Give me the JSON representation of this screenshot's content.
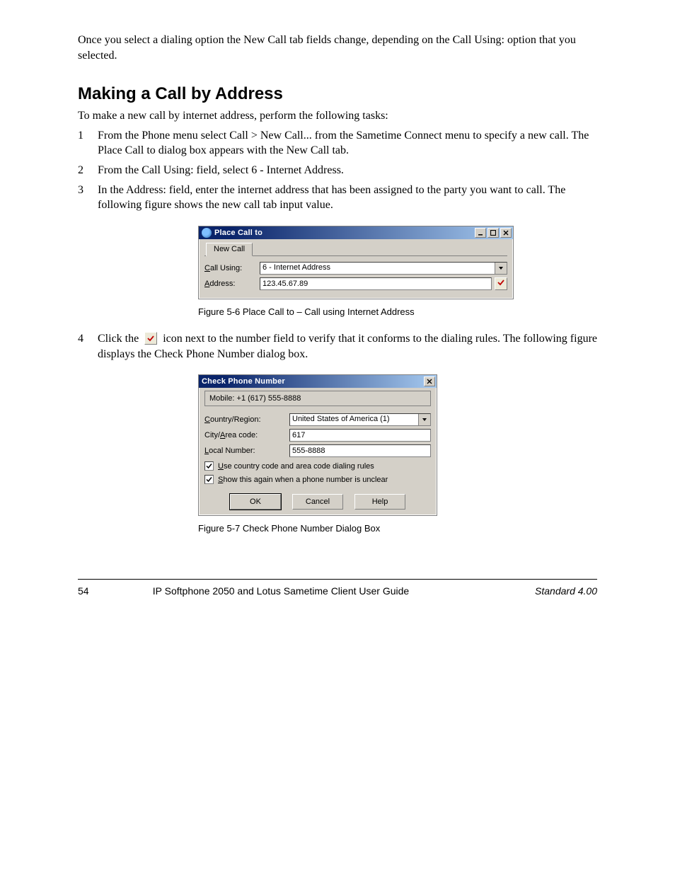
{
  "doc": {
    "intro": "Once you select a dialing option the New Call tab fields change, depending on the Call Using: option that you selected.",
    "section_title": "Making a Call by Address",
    "section_sub": "To make a new call by internet address, perform the following tasks:",
    "steps": [
      "From the Phone menu select Call > New Call... from the Sametime Connect menu to specify a new call. The Place Call to dialog box appears with the New Call tab.",
      "From the Call Using: field, select 6 - Internet Address.",
      "In the Address: field, enter the internet address that has been assigned to the party you want to call. The following figure shows the new call tab input value."
    ],
    "fig1_caption": "Figure 5-6    Place Call to – Call using Internet Address",
    "step4_a": "Click the ",
    "step4_b": "icon next to the number field to verify that it conforms to the dialing rules. The following figure displays the Check Phone Number dialog box.",
    "fig2_caption": "Figure 5-7    Check Phone Number Dialog Box"
  },
  "dlg1": {
    "title": "Place Call to",
    "tab": "New Call",
    "call_using_label_pre": "C",
    "call_using_label_post": "all Using:",
    "call_using_value": "6 - Internet Address",
    "address_label_pre": "A",
    "address_label_post": "ddress:",
    "address_value": "123.45.67.89"
  },
  "dlg2": {
    "title": "Check Phone Number",
    "readonly": "Mobile:  +1 (617) 555-8888",
    "country_label_pre": "C",
    "country_label_post": "ountry/Region:",
    "country_value": "United States of America (1)",
    "area_label_a": "City/",
    "area_label_u": "A",
    "area_label_b": "rea code:",
    "area_value": "617",
    "local_label_u": "L",
    "local_label_post": "ocal Number:",
    "local_value": "555-8888",
    "chk1_u": "U",
    "chk1_post": "se country code and area code dialing rules",
    "chk2_u": "S",
    "chk2_post": "how this again when a phone number is unclear",
    "ok": "OK",
    "cancel": "Cancel",
    "help": "Help"
  },
  "footer": {
    "page": "54",
    "center": "IP Softphone 2050 and Lotus Sametime Client User Guide",
    "right": "Standard 4.00"
  }
}
